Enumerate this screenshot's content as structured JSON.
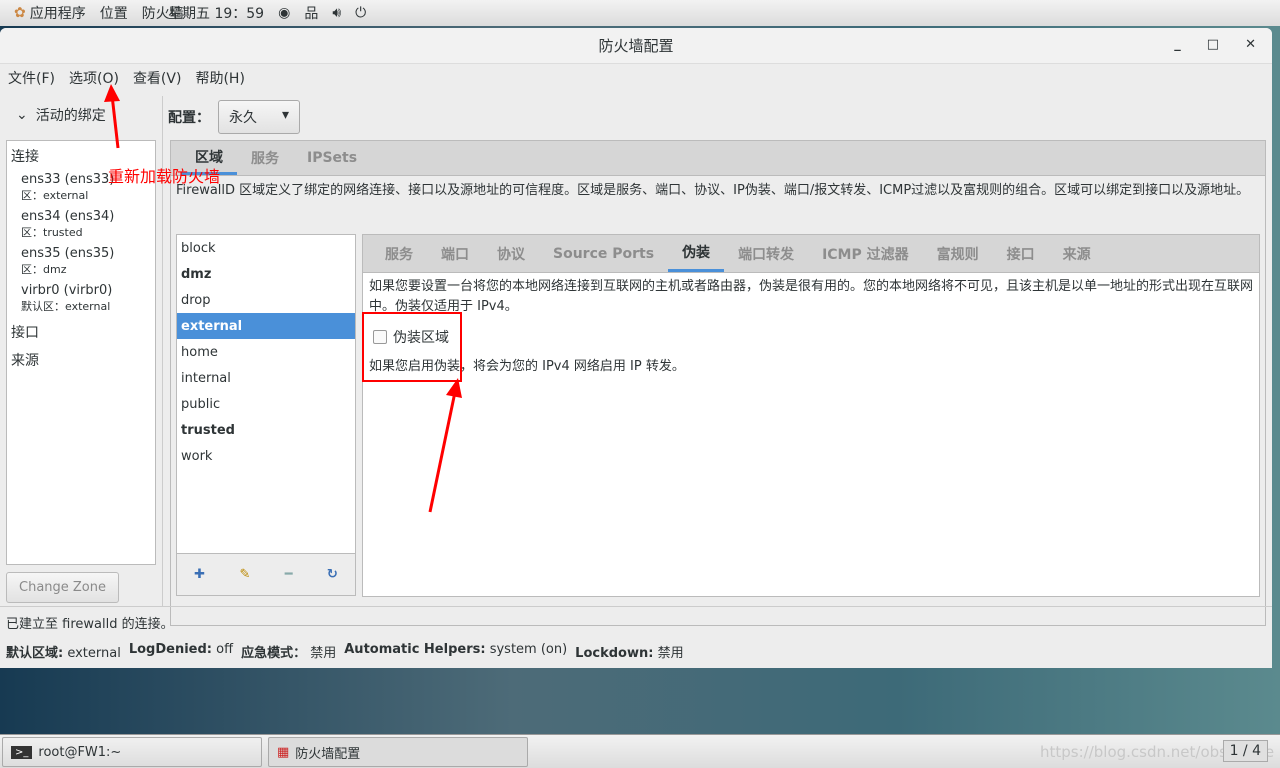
{
  "topbar": {
    "apps": "应用程序",
    "places": "位置",
    "firewall": "防火墙",
    "clock": "星期五 19：59",
    "icons": [
      "accessibility-icon",
      "network-icon",
      "volume-icon",
      "power-icon"
    ]
  },
  "window": {
    "title": "防火墙配置"
  },
  "menu": [
    "文件(F)",
    "选项(O)",
    "查看(V)",
    "帮助(H)"
  ],
  "bindings": {
    "header": "活动的绑定",
    "connections": "连接",
    "items": [
      {
        "name": "ens33 (ens33)",
        "zone": "区：external"
      },
      {
        "name": "ens34 (ens34)",
        "zone": "区：trusted"
      },
      {
        "name": "ens35 (ens35)",
        "zone": "区：dmz"
      },
      {
        "name": "virbr0 (virbr0)",
        "zone": "默认区：external"
      }
    ],
    "interfaces": "接口",
    "sources": "来源",
    "change_zone": "Change Zone"
  },
  "config": {
    "label": "配置：",
    "value": "永久"
  },
  "top_tabs": [
    "区域",
    "服务",
    "IPSets"
  ],
  "zone_desc": "FirewallD 区域定义了绑定的网络连接、接口以及源地址的可信程度。区域是服务、端口、协议、IP伪装、端口/报文转发、ICMP过滤以及富规则的组合。区域可以绑定到接口以及源地址。",
  "zones": [
    {
      "n": "block",
      "b": false
    },
    {
      "n": "dmz",
      "b": true
    },
    {
      "n": "drop",
      "b": false
    },
    {
      "n": "external",
      "b": true
    },
    {
      "n": "home",
      "b": false
    },
    {
      "n": "internal",
      "b": false
    },
    {
      "n": "public",
      "b": false
    },
    {
      "n": "trusted",
      "b": true
    },
    {
      "n": "work",
      "b": false
    }
  ],
  "selected_zone": "external",
  "zone_tabs": [
    "服务",
    "端口",
    "协议",
    "Source Ports",
    "伪装",
    "端口转发",
    "ICMP 过滤器",
    "富规则",
    "接口",
    "来源"
  ],
  "active_zone_tab": "伪装",
  "masq": {
    "desc": "如果您要设置一台将您的本地网络连接到互联网的主机或者路由器，伪装是很有用的。您的本地网络将不可见，且该主机是以单一地址的形式出现在互联网中。伪装仅适用于 IPv4。",
    "checkbox": "伪装区域",
    "checked": false,
    "note": "如果您启用伪装，将会为您的 IPv4 网络启用 IP 转发。"
  },
  "annotation": "重新加载防火墙",
  "status": {
    "line1": "已建立至 firewalld 的连接。",
    "default_zone_k": "默认区域:",
    "default_zone_v": "external",
    "logdenied_k": "LogDenied:",
    "logdenied_v": "off",
    "panic_k": "应急模式：",
    "panic_v": "禁用",
    "helpers_k": "Automatic Helpers:",
    "helpers_v": "system (on)",
    "lockdown_k": "Lockdown:",
    "lockdown_v": "禁用"
  },
  "taskbar": {
    "terminal": "root@FW1:~",
    "firewall": "防火墙配置",
    "pager": "1 / 4",
    "watermark": "https://blog.csdn.net/obsessive"
  }
}
